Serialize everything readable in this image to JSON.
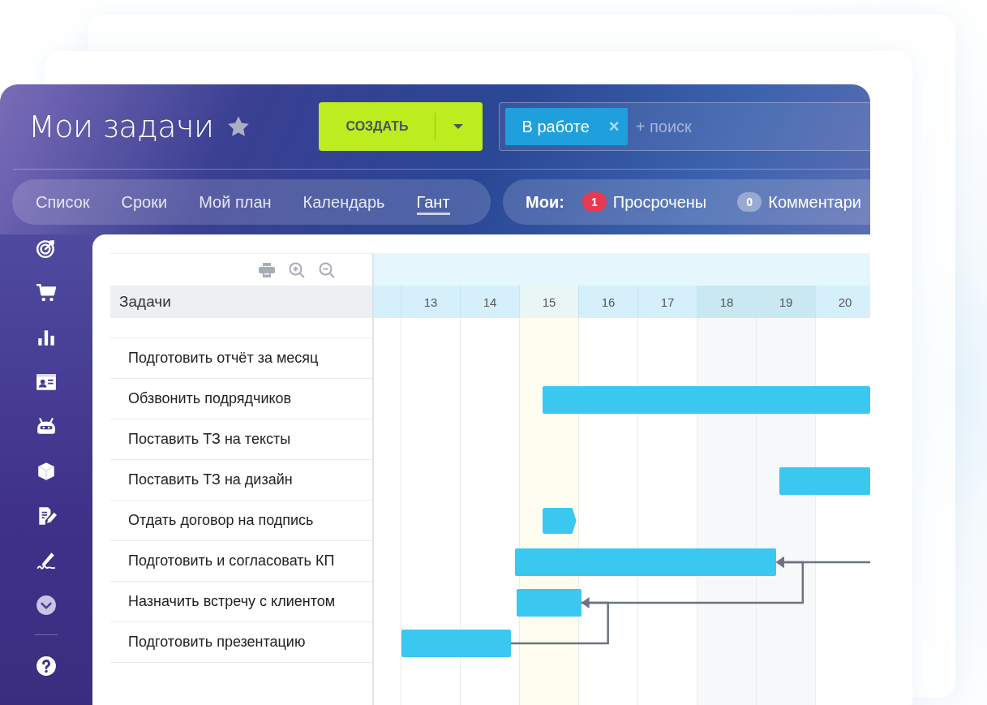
{
  "header": {
    "title": "Мои задачи",
    "favorite": false,
    "create_button": "СОЗДАТЬ",
    "search": {
      "chips": [
        {
          "label": "В работе",
          "remove": "×"
        }
      ],
      "placeholder": "+ поиск"
    }
  },
  "view_tabs": [
    {
      "label": "Список",
      "selected": false
    },
    {
      "label": "Сроки",
      "selected": false
    },
    {
      "label": "Мой план",
      "selected": false
    },
    {
      "label": "Календарь",
      "selected": false
    },
    {
      "label": "Гант",
      "selected": true
    }
  ],
  "counters": {
    "label": "Мои:",
    "items": [
      {
        "count": "1",
        "label": "Просрочены",
        "kind": "alert"
      },
      {
        "count": "0",
        "label": "Комментари",
        "kind": "muted"
      }
    ]
  },
  "sidebar": [
    {
      "kind": "target"
    },
    {
      "kind": "cart"
    },
    {
      "kind": "chart"
    },
    {
      "kind": "contact"
    },
    {
      "kind": "robot"
    },
    {
      "kind": "cube"
    },
    {
      "kind": "document"
    },
    {
      "kind": "signature"
    },
    {
      "kind": "more"
    },
    {
      "kind": "help"
    }
  ],
  "gantt": {
    "column_title": "Задачи",
    "days": [
      {
        "label": "13",
        "kind": "workday"
      },
      {
        "label": "14",
        "kind": "workday"
      },
      {
        "label": "15",
        "kind": "today"
      },
      {
        "label": "16",
        "kind": "workday"
      },
      {
        "label": "17",
        "kind": "workday"
      },
      {
        "label": "18",
        "kind": "weekend"
      },
      {
        "label": "19",
        "kind": "weekend"
      },
      {
        "label": "20",
        "kind": "workday"
      }
    ],
    "tasks": [
      {
        "title": "Подготовить отчёт за месяц"
      },
      {
        "title": "Обзвонить подрядчиков",
        "kind": "bar"
      },
      {
        "title": "Поставить ТЗ на тексты"
      },
      {
        "title": "Поставить ТЗ на дизайн",
        "kind": "bar"
      },
      {
        "title": "Отдать договор на подпись",
        "kind": "milestone"
      },
      {
        "title": "Подготовить и согласовать КП",
        "kind": "bar"
      },
      {
        "title": "Назначить встречу с клиентом",
        "kind": "bar"
      },
      {
        "title": "Подготовить презентацию",
        "kind": "bar"
      }
    ]
  }
}
